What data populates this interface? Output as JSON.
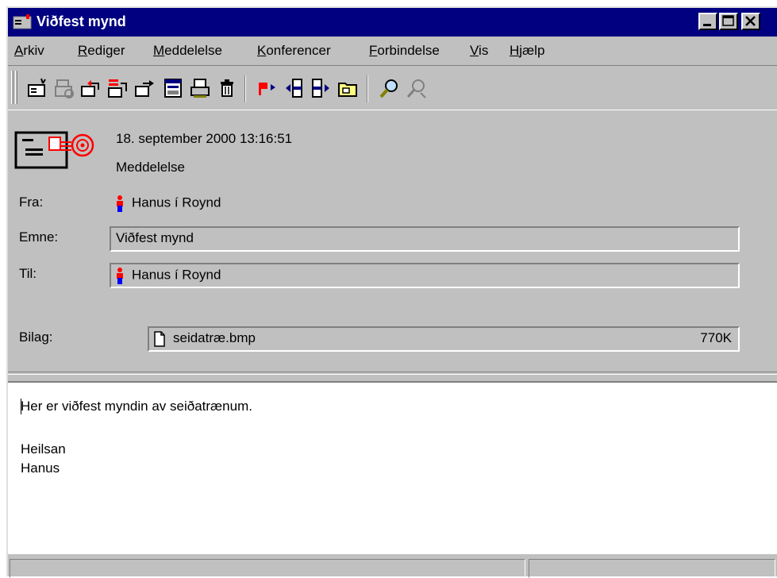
{
  "window": {
    "title": "Viðfest mynd",
    "title_bar_color": "#000080",
    "face_color": "#c0c0c0"
  },
  "menu": [
    "Arkiv",
    "Rediger",
    "Meddelelse",
    "Konferencer",
    "Forbindelse",
    "Vis",
    "Hjælp"
  ],
  "toolbar_icons": [
    "new-message-icon",
    "print-disabled-icon",
    "reply-icon",
    "reply-all-icon",
    "forward-icon",
    "save-icon",
    "print-icon",
    "delete-icon",
    "flag-next-icon",
    "previous-icon",
    "next-icon",
    "folder-icon",
    "find-icon",
    "find-next-icon"
  ],
  "header": {
    "date": "18. september 2000 13:16:51",
    "type": "Meddelelse",
    "from_label": "Fra:",
    "from_value": "Hanus í Roynd",
    "subject_label": "Emne:",
    "subject_value": "Viðfest mynd",
    "to_label": "Til:",
    "to_value": "Hanus í Roynd",
    "attachment_label": "Bilag:",
    "attachment_name": "seidatræ.bmp",
    "attachment_size": "770K"
  },
  "body": {
    "line1": "Her er viðfest myndin av seiðatrænum.",
    "line2": "Heilsan",
    "line3": "Hanus"
  }
}
